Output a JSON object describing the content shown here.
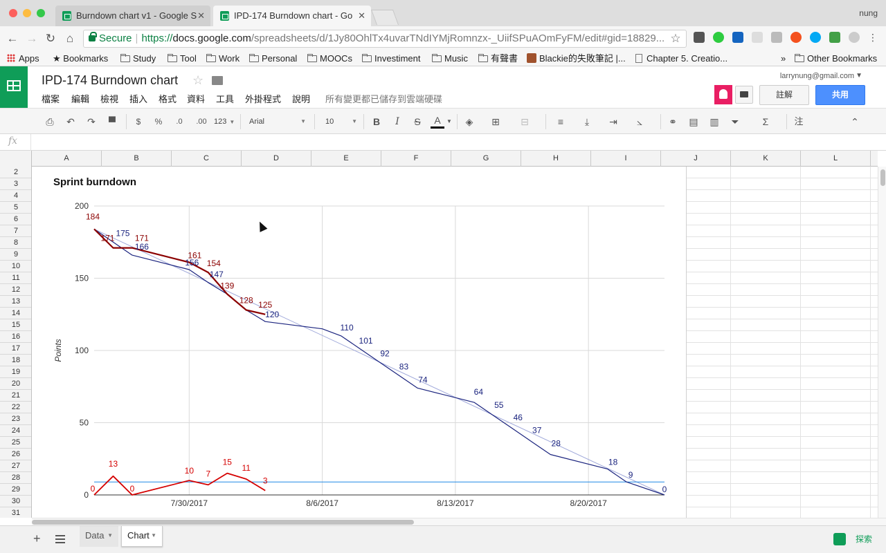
{
  "browser": {
    "tabs": [
      {
        "label": "Burndown chart v1 - Google S",
        "active": false
      },
      {
        "label": "IPD-174 Burndown chart - Go",
        "active": true
      }
    ],
    "profile_name": "nung",
    "url": {
      "secure_label": "Secure",
      "scheme": "https://",
      "host": "docs.google.com",
      "path": "/spreadsheets/d/1Jy80OhlTx4uvarTNdIYMjRomnzx-_UiifSPuAOmFyFM/edit#gid=18829..."
    },
    "bookmarks": [
      {
        "label": "Apps",
        "icon": "apps-grid-icon"
      },
      {
        "label": "Bookmarks",
        "icon": "star-icon"
      },
      {
        "label": "Study",
        "icon": "folder-icon"
      },
      {
        "label": "Tool",
        "icon": "folder-icon"
      },
      {
        "label": "Work",
        "icon": "folder-icon"
      },
      {
        "label": "Personal",
        "icon": "folder-icon"
      },
      {
        "label": "MOOCs",
        "icon": "folder-icon"
      },
      {
        "label": "Investiment",
        "icon": "folder-icon"
      },
      {
        "label": "Music",
        "icon": "folder-icon"
      },
      {
        "label": "有聲書",
        "icon": "folder-icon"
      },
      {
        "label": "Blackie的失敗筆記 |...",
        "icon": "avatar-icon"
      },
      {
        "label": "Chapter 5. Creatio...",
        "icon": "page-icon"
      },
      {
        "label": "Other Bookmarks",
        "icon": "folder-icon"
      }
    ],
    "bookmarks_overflow": "»"
  },
  "sheets": {
    "title": "IPD-174 Burndown chart",
    "menu": [
      "檔案",
      "編輯",
      "檢視",
      "插入",
      "格式",
      "資料",
      "工具",
      "外掛程式",
      "說明"
    ],
    "saved_status": "所有變更都已儲存到雲端硬碟",
    "account": "larrynung@gmail.com",
    "comment_label": "註解",
    "share_label": "共用",
    "toolbar": {
      "currency": "$",
      "percent": "%",
      "dec_less": ".0",
      "dec_more": ".00",
      "number_format": "123",
      "font": "Arial",
      "font_size": "10",
      "bold": "B",
      "italic": "I",
      "strike": "S",
      "text_color": "A",
      "note": "注"
    },
    "formula_label": "fx",
    "columns": [
      "A",
      "B",
      "C",
      "D",
      "E",
      "F",
      "G",
      "H",
      "I",
      "J",
      "K",
      "L"
    ],
    "rows": [
      "2",
      "3",
      "4",
      "5",
      "6",
      "7",
      "8",
      "9",
      "10",
      "11",
      "12",
      "13",
      "14",
      "15",
      "16",
      "17",
      "18",
      "19",
      "20",
      "21",
      "22",
      "23",
      "24",
      "25",
      "26",
      "27",
      "28",
      "29",
      "30",
      "31"
    ],
    "sheet_tabs": [
      {
        "label": "Data",
        "active": false
      },
      {
        "label": "Chart",
        "active": true
      }
    ],
    "explore_label": "探索"
  },
  "chart_data": {
    "type": "line",
    "title": "Sprint burndown",
    "xlabel": "",
    "ylabel": "Points",
    "ylim": [
      0,
      200
    ],
    "yticks": [
      0,
      50,
      100,
      150,
      200
    ],
    "xlim": [
      "7/25/2017",
      "8/24/2017"
    ],
    "xticks": [
      "7/30/2017",
      "8/6/2017",
      "8/13/2017",
      "8/20/2017"
    ],
    "grid": true,
    "series": [
      {
        "color": "#1a237e",
        "points": [
          {
            "x": "7/25/2017",
            "y": 184,
            "label": ""
          },
          {
            "x": "7/26/2017",
            "y": 175,
            "label": "175"
          },
          {
            "x": "7/27/2017",
            "y": 166,
            "label": "166"
          },
          {
            "x": "7/30/2017",
            "y": 156,
            "label": "156"
          },
          {
            "x": "7/31/2017",
            "y": 147,
            "label": "147"
          },
          {
            "x": "8/1/2017",
            "y": 139,
            "label": ""
          },
          {
            "x": "8/2/2017",
            "y": 128,
            "label": ""
          },
          {
            "x": "8/3/2017",
            "y": 120,
            "label": "120"
          },
          {
            "x": "8/6/2017",
            "y": 115,
            "label": ""
          },
          {
            "x": "8/7/2017",
            "y": 110,
            "label": "110"
          },
          {
            "x": "8/8/2017",
            "y": 101,
            "label": "101"
          },
          {
            "x": "8/9/2017",
            "y": 92,
            "label": "92"
          },
          {
            "x": "8/10/2017",
            "y": 83,
            "label": "83"
          },
          {
            "x": "8/11/2017",
            "y": 74,
            "label": "74"
          },
          {
            "x": "8/14/2017",
            "y": 64,
            "label": "64"
          },
          {
            "x": "8/15/2017",
            "y": 55,
            "label": "55"
          },
          {
            "x": "8/16/2017",
            "y": 46,
            "label": "46"
          },
          {
            "x": "8/17/2017",
            "y": 37,
            "label": "37"
          },
          {
            "x": "8/18/2017",
            "y": 28,
            "label": "28"
          },
          {
            "x": "8/21/2017",
            "y": 18,
            "label": "18"
          },
          {
            "x": "8/22/2017",
            "y": 9,
            "label": "9"
          },
          {
            "x": "8/24/2017",
            "y": 0,
            "label": "0"
          }
        ]
      },
      {
        "color": "#8b0000",
        "points": [
          {
            "x": "7/25/2017",
            "y": 184,
            "label": "184"
          },
          {
            "x": "7/26/2017",
            "y": 171,
            "label": "171"
          },
          {
            "x": "7/27/2017",
            "y": 171,
            "label": "171"
          },
          {
            "x": "7/30/2017",
            "y": 161,
            "label": "161"
          },
          {
            "x": "7/31/2017",
            "y": 154,
            "label": "154"
          },
          {
            "x": "8/1/2017",
            "y": 139,
            "label": "139"
          },
          {
            "x": "8/2/2017",
            "y": 128,
            "label": "128"
          },
          {
            "x": "8/3/2017",
            "y": 125,
            "label": "125"
          }
        ]
      },
      {
        "color": "#d50000",
        "points": [
          {
            "x": "7/25/2017",
            "y": 0,
            "label": "0"
          },
          {
            "x": "7/26/2017",
            "y": 13,
            "label": "13"
          },
          {
            "x": "7/27/2017",
            "y": 0,
            "label": "0"
          },
          {
            "x": "7/30/2017",
            "y": 10,
            "label": "10"
          },
          {
            "x": "7/31/2017",
            "y": 7,
            "label": "7"
          },
          {
            "x": "8/1/2017",
            "y": 15,
            "label": "15"
          },
          {
            "x": "8/2/2017",
            "y": 11,
            "label": "11"
          },
          {
            "x": "8/3/2017",
            "y": 3,
            "label": "3"
          }
        ]
      },
      {
        "color": "#9fa8da",
        "points": [
          {
            "x": "7/25/2017",
            "y": 184
          },
          {
            "x": "8/24/2017",
            "y": 0
          }
        ]
      },
      {
        "color": "#1e88e5",
        "points": [
          {
            "x": "7/25/2017",
            "y": 9
          },
          {
            "x": "8/24/2017",
            "y": 9
          }
        ]
      }
    ]
  }
}
